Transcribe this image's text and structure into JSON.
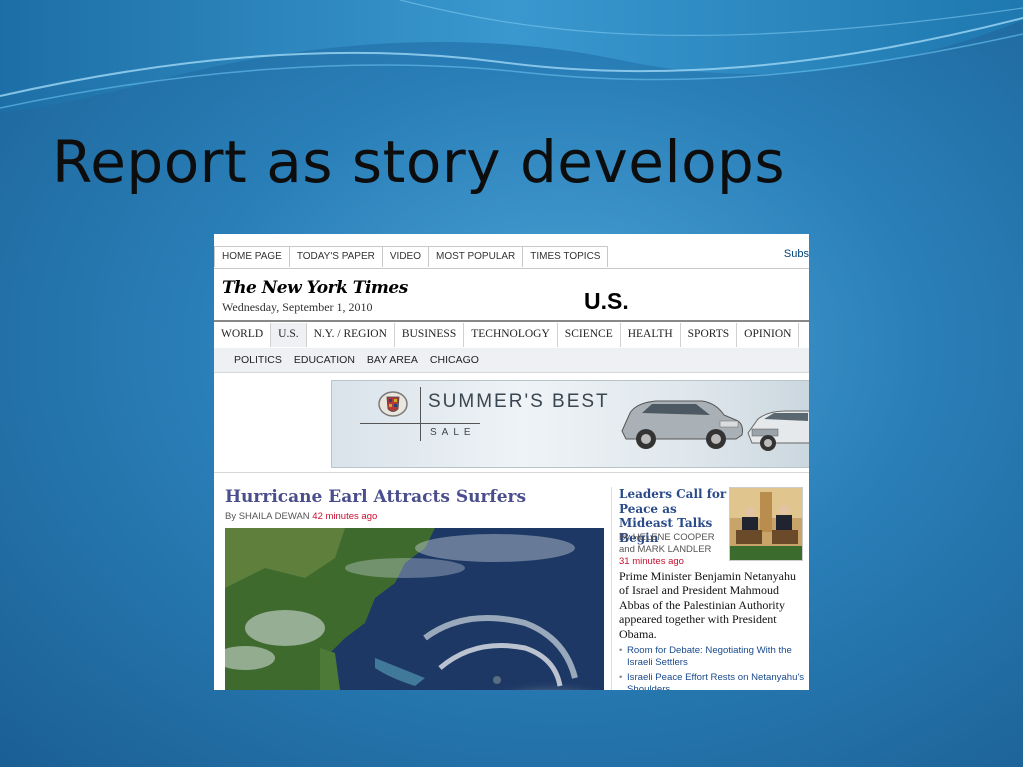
{
  "slide": {
    "title": "Report as story develops"
  },
  "nyt": {
    "top_nav": [
      "HOME PAGE",
      "TODAY'S PAPER",
      "VIDEO",
      "MOST POPULAR",
      "TIMES TOPICS"
    ],
    "subscribe_partial": "Subs",
    "masthead": "The New York Times",
    "date": "Wednesday, September 1, 2010",
    "section_title": "U.S.",
    "section_nav": [
      "WORLD",
      "U.S.",
      "N.Y. / REGION",
      "BUSINESS",
      "TECHNOLOGY",
      "SCIENCE",
      "HEALTH",
      "SPORTS",
      "OPINION"
    ],
    "active_section": "U.S.",
    "sub_nav": [
      "POLITICS",
      "EDUCATION",
      "BAY AREA",
      "CHICAGO"
    ],
    "ad": {
      "headline": "SUMMER'S BEST",
      "subline": "SALE"
    },
    "lead": {
      "headline": "Hurricane Earl Attracts Surfers",
      "byline": "By SHAILA DEWAN",
      "time": "42 minutes ago"
    },
    "side": {
      "headline": "Leaders Call for Peace as Mideast Talks Begin",
      "byline": "By HELENE COOPER and MARK LANDLER",
      "time": "31 minutes ago",
      "body": "Prime Minister Benjamin Netanyahu of Israel and President Mahmoud Abbas of the Palestinian Authority appeared together with President Obama.",
      "links": [
        "Room for Debate: Negotiating With the Israeli Settlers",
        "Israeli Peace Effort Rests on Netanyahu's Shoulders"
      ]
    }
  }
}
